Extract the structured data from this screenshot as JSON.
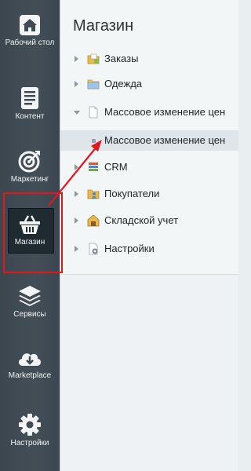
{
  "leftbar": {
    "items": [
      {
        "label": "Рабочий стол",
        "icon": "home-icon"
      },
      {
        "label": "Контент",
        "icon": "document-icon"
      },
      {
        "label": "Маркетинг",
        "icon": "target-icon"
      },
      {
        "label": "Магазин",
        "icon": "basket-icon"
      },
      {
        "label": "Сервисы",
        "icon": "layers-icon"
      },
      {
        "label": "Marketplace",
        "icon": "cloud-download-icon"
      },
      {
        "label": "Настройки",
        "icon": "gear-icon"
      }
    ]
  },
  "panel": {
    "title": "Магазин",
    "tree": [
      {
        "label": "Заказы",
        "icon": "orders-folder-icon"
      },
      {
        "label": "Одежда",
        "icon": "folder-icon"
      },
      {
        "label": "Массовое изменение цен",
        "icon": "page-icon",
        "expanded": true
      },
      {
        "label": "Массовое изменение цен",
        "sub": true
      },
      {
        "label": "CRM",
        "icon": "crm-icon"
      },
      {
        "label": "Покупатели",
        "icon": "users-icon"
      },
      {
        "label": "Складской учет",
        "icon": "warehouse-icon"
      },
      {
        "label": "Настройки",
        "icon": "settings-page-icon"
      }
    ]
  },
  "colors": {
    "highlight_frame": "#e3161b",
    "arrow": "#e3161b"
  }
}
